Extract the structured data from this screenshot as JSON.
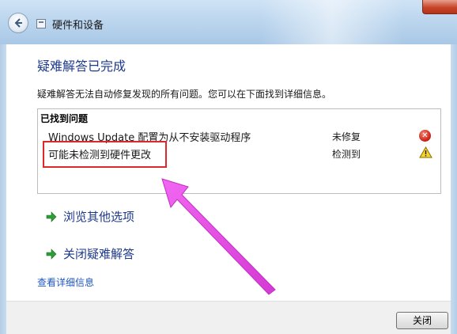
{
  "window": {
    "breadcrumb": "硬件和设备"
  },
  "main": {
    "heading": "疑难解答已完成",
    "description": "疑难解答无法自动修复发现的所有问题。您可以在下面找到详细信息。",
    "problems_title": "已找到问题",
    "problems": [
      {
        "name": "Windows Update 配置为从不安装驱动程序",
        "status": "未修复",
        "icon": "error-icon"
      },
      {
        "name": "可能未检测到硬件更改",
        "status": "检测到",
        "icon": "warning-icon"
      }
    ],
    "options": [
      {
        "label": "浏览其他选项",
        "icon": "green-arrow-icon"
      },
      {
        "label": "关闭疑难解答",
        "icon": "green-arrow-icon"
      }
    ],
    "details_link": "查看详细信息"
  },
  "footer": {
    "close_label": "关闭"
  },
  "colors": {
    "heading": "#1e3a8a",
    "highlight": "#e0282a",
    "annotation_arrow": "#ee44ee"
  }
}
